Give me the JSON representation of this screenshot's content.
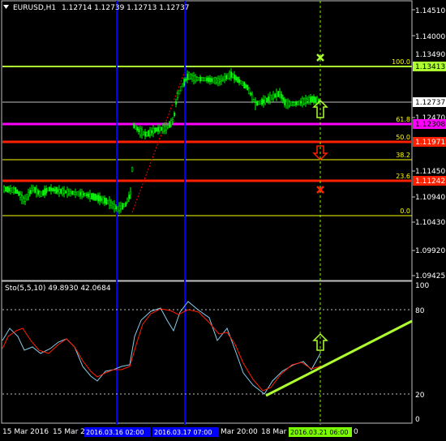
{
  "header": {
    "symbol_label": "EURUSD,H1",
    "ohlc_text": "1.12714 1.12739 1.12713 1.12737",
    "menu_arrow": "▼"
  },
  "price_axis": {
    "ticks": [
      "1.14510",
      "1.14000",
      "1.13490",
      "1.12470",
      "1.11960",
      "1.11450",
      "1.10940",
      "1.10430",
      "1.09920",
      "1.09425"
    ],
    "current_price": "1.12737"
  },
  "fib_levels": [
    {
      "pct": "100.0",
      "price": "1.13413",
      "color": "#ADFF2F",
      "text_color": "#000000"
    },
    {
      "pct": "61.8",
      "price": "1.12308",
      "color": "#FF00FF",
      "text_color": "#000000"
    },
    {
      "pct": "50.0",
      "price": "1.11971",
      "color": "#FF2000",
      "text_color": "#FFFFFF"
    },
    {
      "pct": "38.2",
      "price": "",
      "color": "#FFFF00",
      "text_color": "#000000"
    },
    {
      "pct": "23.6",
      "price": "1.11242",
      "color": "#FF2000",
      "text_color": "#FFFFFF"
    },
    {
      "pct": "0.0",
      "price": "",
      "color": "#FFFF00",
      "text_color": "#000000"
    }
  ],
  "signals": {
    "up_arrow_color": "#ADFF2F",
    "down_arrow_color": "#FF2000",
    "cross_green": "#ADFF2F",
    "cross_red": "#FF2000"
  },
  "indicator": {
    "label": "Sto(5,5,10) 49.8930 42.0684",
    "axis_ticks": [
      "100",
      "80",
      "20",
      "0"
    ],
    "main_color": "#FF2000",
    "signal_color": "#87CEEB",
    "trendline_color": "#ADFF2F"
  },
  "time_axis": {
    "labels": [
      "15 Mar 2016",
      "15 Mar 2",
      "Mar 20:00",
      "18 Mar"
    ],
    "highlight_labels": [
      "2016.03.16 02:00",
      "2016.03.17 07:00"
    ],
    "cursor_label": "2016.03.21 06:00",
    "tail_label": "0"
  },
  "colors": {
    "bull_bear": "#00FF00",
    "vertical_lines": "#0000FF",
    "grid": "#C0C0C0",
    "dashed_cursor": "#7CFC00",
    "fib_diagonal": "#FF0000"
  }
}
